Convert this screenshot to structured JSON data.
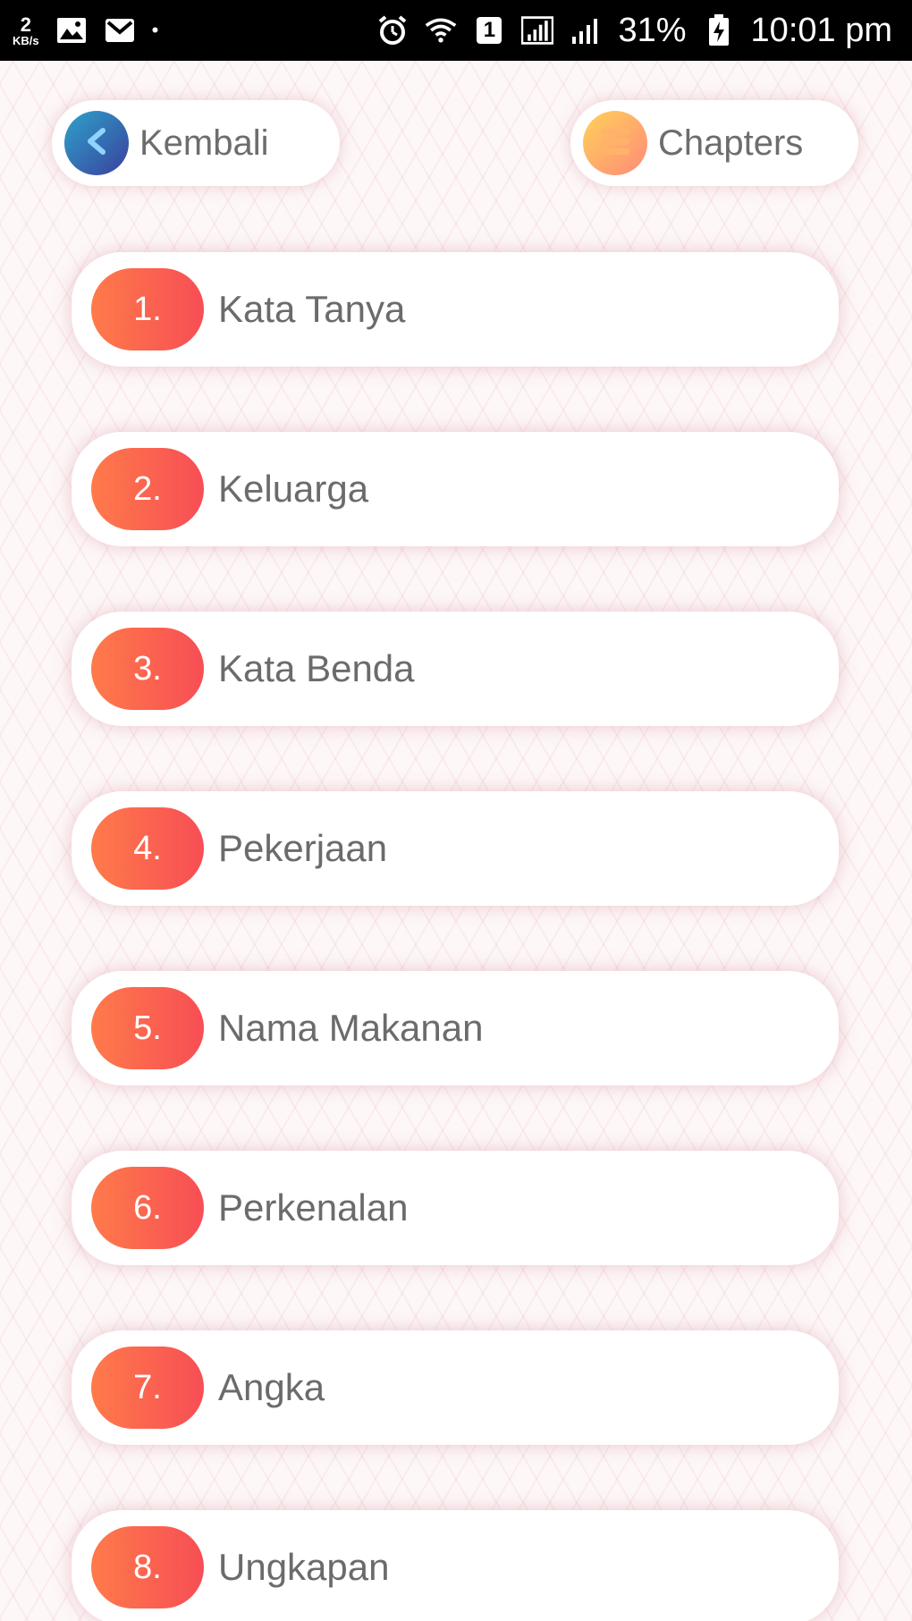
{
  "status_bar": {
    "speed_value": "2",
    "speed_unit": "KB/s",
    "sim_slot": "1",
    "battery": "31%",
    "time": "10:01 pm"
  },
  "header": {
    "back_label": "Kembali",
    "chapters_label": "Chapters"
  },
  "chapters": [
    {
      "number": "1.",
      "title": "Kata Tanya"
    },
    {
      "number": "2.",
      "title": "Keluarga"
    },
    {
      "number": "3.",
      "title": "Kata Benda"
    },
    {
      "number": "4.",
      "title": "Pekerjaan"
    },
    {
      "number": "5.",
      "title": "Nama Makanan"
    },
    {
      "number": "6.",
      "title": "Perkenalan"
    },
    {
      "number": "7.",
      "title": "Angka"
    },
    {
      "number": "8.",
      "title": "Ungkapan"
    }
  ],
  "colors": {
    "badge_start": "#ff7a4a",
    "badge_end": "#f74e55",
    "back_circle_start": "#2ea3c9",
    "back_circle_end": "#3a3f9e",
    "chapters_circle_start": "#ffd259",
    "chapters_circle_end": "#ff8a7a",
    "text": "#6b6b6b"
  },
  "icons": {
    "back": "chevron-left-icon",
    "chapters": "menu-icon"
  }
}
